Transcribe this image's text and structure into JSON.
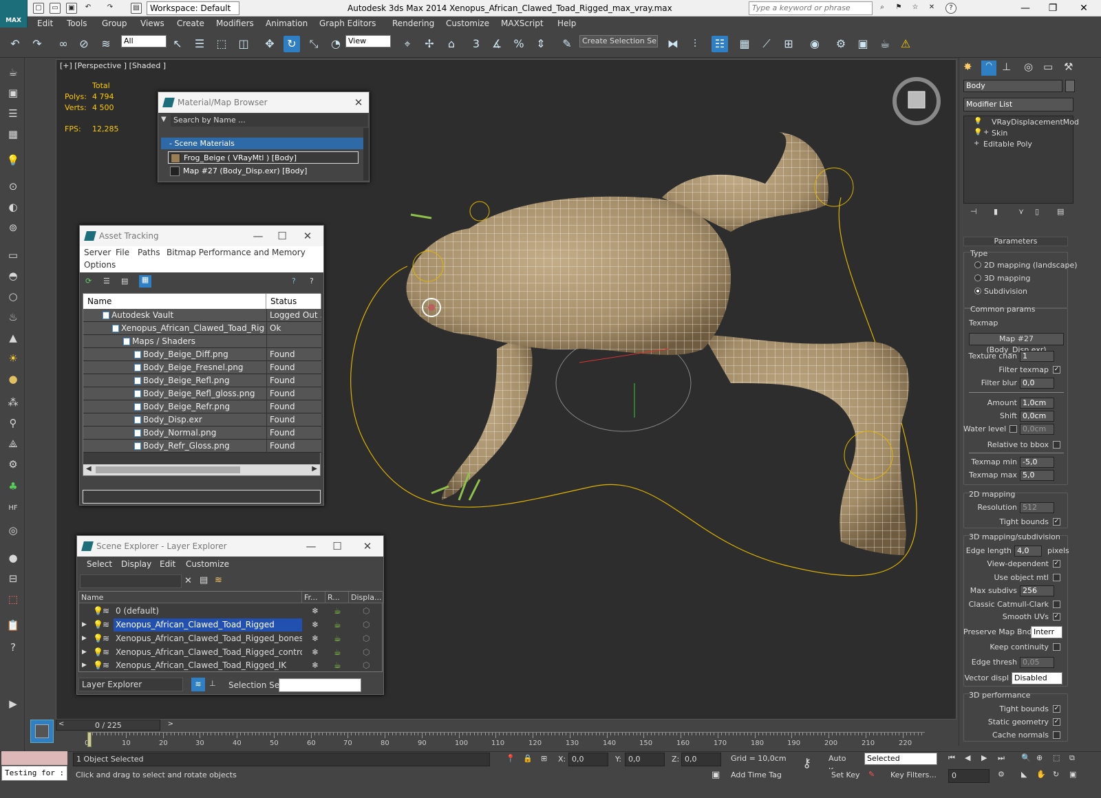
{
  "app": {
    "title": "Autodesk 3ds Max  2014    Xenopus_African_Clawed_Toad_Rigged_max_vray.max",
    "logo": "MAX",
    "workspace": "Workspace: Default",
    "keyword_placeholder": "Type a keyword or phrase"
  },
  "menu": [
    "Edit",
    "Tools",
    "Group",
    "Views",
    "Create",
    "Modifiers",
    "Animation",
    "Graph Editors",
    "Rendering",
    "Customize",
    "MAXScript",
    "Help"
  ],
  "toolbar": {
    "filter": "All",
    "refcoord": "View",
    "selection_set_placeholder": "Create Selection Se",
    "snap_labels": [
      "3",
      "%"
    ]
  },
  "viewport": {
    "label": "[+] [Perspective ] [Shaded ]",
    "stats": {
      "header": "Total",
      "polys_label": "Polys:",
      "polys": "4 794",
      "verts_label": "Verts:",
      "verts": "4 500",
      "fps_label": "FPS:",
      "fps": "12,285"
    }
  },
  "material_browser": {
    "title": "Material/Map Browser",
    "search_placeholder": "Search by Name ...",
    "group": "- Scene Materials",
    "items": [
      "Frog_Beige  ( VRayMtl )  [Body]",
      "Map #27 (Body_Disp.exr)  [Body]"
    ]
  },
  "asset_tracking": {
    "title": "Asset Tracking",
    "menu": [
      "Server",
      "File",
      "Paths",
      "Bitmap Performance and Memory",
      "Options"
    ],
    "col_name": "Name",
    "col_status": "Status",
    "rows": [
      {
        "name": "Autodesk Vault",
        "status": "Logged Out ..."
      },
      {
        "name": "Xenopus_African_Clawed_Toad_Rigge...",
        "status": "Ok"
      },
      {
        "name": "Maps / Shaders",
        "status": ""
      },
      {
        "name": "Body_Beige_Diff.png",
        "status": "Found"
      },
      {
        "name": "Body_Beige_Fresnel.png",
        "status": "Found"
      },
      {
        "name": "Body_Beige_Refl.png",
        "status": "Found"
      },
      {
        "name": "Body_Beige_Refl_gloss.png",
        "status": "Found"
      },
      {
        "name": "Body_Beige_Refr.png",
        "status": "Found"
      },
      {
        "name": "Body_Disp.exr",
        "status": "Found"
      },
      {
        "name": "Body_Normal.png",
        "status": "Found"
      },
      {
        "name": "Body_Refr_Gloss.png",
        "status": "Found"
      }
    ]
  },
  "scene_explorer": {
    "title": "Scene Explorer - Layer Explorer",
    "menu": [
      "Select",
      "Display",
      "Edit",
      "Customize"
    ],
    "cols": [
      "Name",
      "Fr...",
      "R...",
      "Displa..."
    ],
    "layers": [
      {
        "name": "0 (default)",
        "selected": false
      },
      {
        "name": "Xenopus_African_Clawed_Toad_Rigged",
        "selected": true
      },
      {
        "name": "Xenopus_African_Clawed_Toad_Rigged_bones",
        "selected": false
      },
      {
        "name": "Xenopus_African_Clawed_Toad_Rigged_controllers",
        "selected": false
      },
      {
        "name": "Xenopus_African_Clawed_Toad_Rigged_IK",
        "selected": false
      }
    ],
    "footer_mode": "Layer Explorer",
    "selection_set_label": "Selection Set:"
  },
  "command_panel": {
    "object_name": "Body",
    "modifier_list": "Modifier List",
    "stack": [
      "VRayDisplacementMod",
      "Skin",
      "Editable Poly"
    ],
    "rollout": "Parameters",
    "type_label": "Type",
    "types": [
      "2D mapping (landscape)",
      "3D mapping",
      "Subdivision"
    ],
    "common_label": "Common params",
    "texmap_label": "Texmap",
    "texmap": "Map #27 (Body_Disp.exr)",
    "texture_chan_label": "Texture chan",
    "texture_chan": "1",
    "filter_texmap_label": "Filter texmap",
    "filter_blur_label": "Filter blur",
    "filter_blur": "0,0",
    "amount_label": "Amount",
    "amount": "1,0cm",
    "shift_label": "Shift",
    "shift": "0,0cm",
    "water_label": "Water level",
    "water": "0,0cm",
    "relative_label": "Relative to bbox",
    "texmap_min_label": "Texmap min",
    "texmap_min": "-5,0",
    "texmap_max_label": "Texmap max",
    "texmap_max": "5,0",
    "map2d_label": "2D mapping",
    "resolution_label": "Resolution",
    "resolution": "512",
    "tight_bounds_label": "Tight bounds",
    "map3d_label": "3D mapping/subdivision",
    "edge_length_label": "Edge length",
    "edge_length": "4,0",
    "pixels_label": "pixels",
    "view_dep_label": "View-dependent",
    "use_obj_label": "Use object mtl",
    "max_subdivs_label": "Max subdivs",
    "max_subdivs": "256",
    "catmull_label": "Classic Catmull-Clark",
    "smooth_uv_label": "Smooth UVs",
    "preserve_label": "Preserve Map Bnd",
    "preserve": "Interr",
    "keep_cont_label": "Keep continuity",
    "edge_thresh_label": "Edge thresh",
    "edge_thresh": "0,05",
    "vector_label": "Vector displ",
    "vector": "Disabled",
    "perf_label": "3D performance",
    "perf_tight_label": "Tight bounds",
    "static_geo_label": "Static geometry",
    "cache_label": "Cache normals"
  },
  "timeline": {
    "frame": "0 / 225",
    "ticks": [
      "0",
      "10",
      "20",
      "30",
      "40",
      "50",
      "60",
      "70",
      "80",
      "90",
      "100",
      "110",
      "120",
      "130",
      "140",
      "150",
      "160",
      "170",
      "180",
      "190",
      "200",
      "210",
      "220"
    ]
  },
  "status": {
    "script": "Testing for :",
    "selection": "1 Object Selected",
    "prompt": "Click and drag to select and rotate objects",
    "x_label": "X:",
    "x": "0,0",
    "y_label": "Y:",
    "y": "0,0",
    "z_label": "Z:",
    "z": "0,0",
    "grid": "Grid = 10,0cm",
    "add_time_tag": "Add Time Tag",
    "auto_key": "Auto Key",
    "set_key": "Set Key",
    "key_mode": "Selected",
    "key_filters": "Key Filters...",
    "current_frame": "0"
  },
  "colors": {
    "accent": "#2f7fc4",
    "selection": "#2250b0",
    "stats_text": "#ffcc00",
    "frog_skin": "#b09a76"
  }
}
